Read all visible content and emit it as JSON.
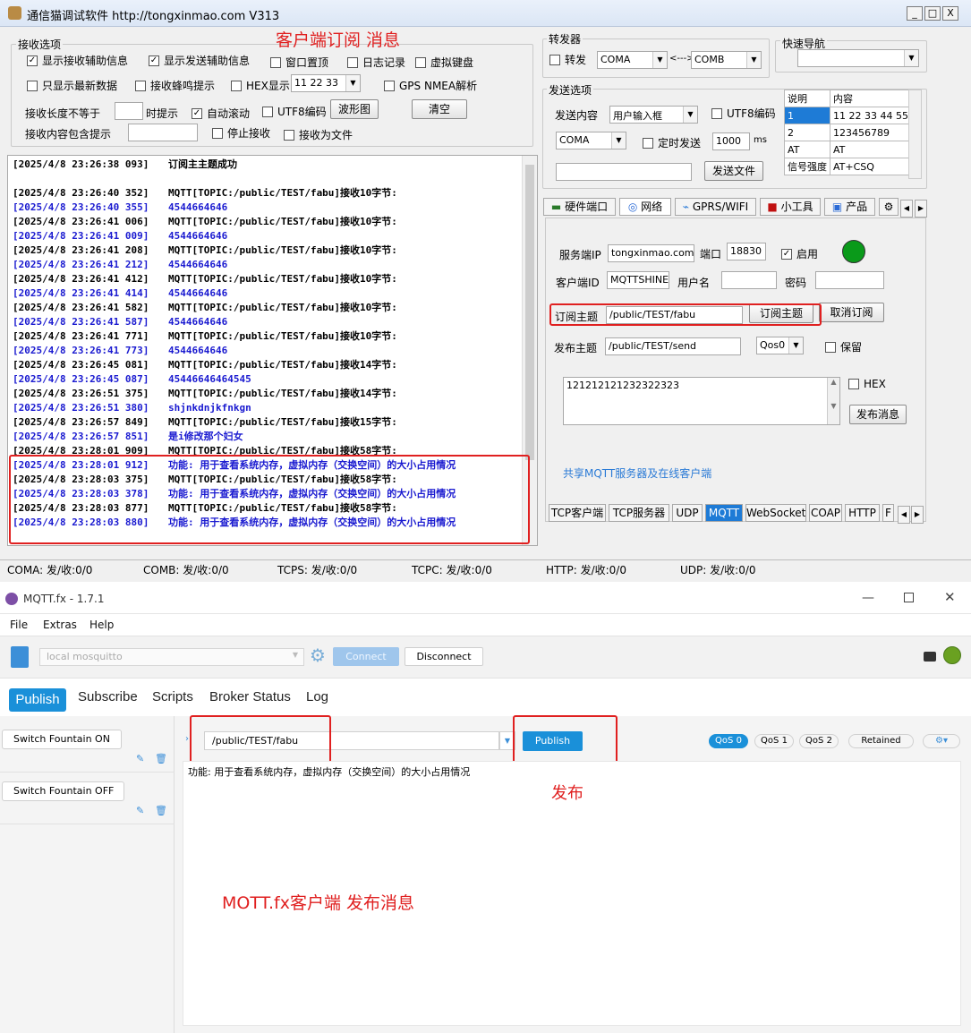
{
  "top_app": {
    "title": "通信猫调试软件  http://tongxinmao.com  V313",
    "window_controls": {
      "minimize": "_",
      "maximize": "□",
      "close": "X"
    },
    "receive_options": {
      "legend": "接收选项",
      "cb_show_recv_aux": "显示接收辅助信息",
      "cb_show_send_aux": "显示发送辅助信息",
      "cb_window_top": "窗口置顶",
      "cb_log": "日志记录",
      "cb_virtual_kbd": "虚拟键盘",
      "cb_latest_only": "只显示最新数据",
      "cb_beep": "接收蜂鸣提示",
      "cb_hex": "HEX显示",
      "hex_value": "11 22 33",
      "cb_gps": "GPS NMEA解析",
      "len_label": "接收长度不等于",
      "len_hint": "时提示",
      "cb_autoscroll": "自动滚动",
      "cb_utf8": "UTF8编码",
      "waveform_btn": "波形图",
      "clear_btn": "清空",
      "contains_label": "接收内容包含提示",
      "cb_stop": "停止接收",
      "cb_to_file": "接收为文件"
    },
    "annotation_subscribe": "客户端订阅   消息",
    "log": [
      {
        "ts": "[2025/4/8 23:26:38 093]",
        "msg": "订阅主主题成功",
        "color": "black"
      },
      {
        "ts": "",
        "msg": "",
        "color": "black"
      },
      {
        "ts": "[2025/4/8 23:26:40 352]",
        "msg": "MQTT[TOPIC:/public/TEST/fabu]接收10字节:",
        "color": "black"
      },
      {
        "ts": "[2025/4/8 23:26:40 355]",
        "msg": "4544664646",
        "color": "blue"
      },
      {
        "ts": "[2025/4/8 23:26:41 006]",
        "msg": "MQTT[TOPIC:/public/TEST/fabu]接收10字节:",
        "color": "black"
      },
      {
        "ts": "[2025/4/8 23:26:41 009]",
        "msg": "4544664646",
        "color": "blue"
      },
      {
        "ts": "[2025/4/8 23:26:41 208]",
        "msg": "MQTT[TOPIC:/public/TEST/fabu]接收10字节:",
        "color": "black"
      },
      {
        "ts": "[2025/4/8 23:26:41 212]",
        "msg": "4544664646",
        "color": "blue"
      },
      {
        "ts": "[2025/4/8 23:26:41 412]",
        "msg": "MQTT[TOPIC:/public/TEST/fabu]接收10字节:",
        "color": "black"
      },
      {
        "ts": "[2025/4/8 23:26:41 414]",
        "msg": "4544664646",
        "color": "blue"
      },
      {
        "ts": "[2025/4/8 23:26:41 582]",
        "msg": "MQTT[TOPIC:/public/TEST/fabu]接收10字节:",
        "color": "black"
      },
      {
        "ts": "[2025/4/8 23:26:41 587]",
        "msg": "4544664646",
        "color": "blue"
      },
      {
        "ts": "[2025/4/8 23:26:41 771]",
        "msg": "MQTT[TOPIC:/public/TEST/fabu]接收10字节:",
        "color": "black"
      },
      {
        "ts": "[2025/4/8 23:26:41 773]",
        "msg": "4544664646",
        "color": "blue"
      },
      {
        "ts": "[2025/4/8 23:26:45 081]",
        "msg": "MQTT[TOPIC:/public/TEST/fabu]接收14字节:",
        "color": "black"
      },
      {
        "ts": "[2025/4/8 23:26:45 087]",
        "msg": "45446646464545",
        "color": "blue"
      },
      {
        "ts": "[2025/4/8 23:26:51 375]",
        "msg": "MQTT[TOPIC:/public/TEST/fabu]接收14字节:",
        "color": "black"
      },
      {
        "ts": "[2025/4/8 23:26:51 380]",
        "msg": "shjnkdnjkfnkgn",
        "color": "blue"
      },
      {
        "ts": "[2025/4/8 23:26:57 849]",
        "msg": "MQTT[TOPIC:/public/TEST/fabu]接收15字节:",
        "color": "black"
      },
      {
        "ts": "[2025/4/8 23:26:57 851]",
        "msg": "是i修改那个妇女",
        "color": "blue"
      },
      {
        "ts": "[2025/4/8 23:28:01 909]",
        "msg": "MQTT[TOPIC:/public/TEST/fabu]接收58字节:",
        "color": "black"
      },
      {
        "ts": "[2025/4/8 23:28:01 912]",
        "msg": "功能: 用于查看系统内存，虚拟内存（交换空间）的大小占用情况",
        "color": "blue"
      },
      {
        "ts": "[2025/4/8 23:28:03 375]",
        "msg": "MQTT[TOPIC:/public/TEST/fabu]接收58字节:",
        "color": "black"
      },
      {
        "ts": "[2025/4/8 23:28:03 378]",
        "msg": "功能: 用于查看系统内存，虚拟内存（交换空间）的大小占用情况",
        "color": "blue"
      },
      {
        "ts": "[2025/4/8 23:28:03 877]",
        "msg": "MQTT[TOPIC:/public/TEST/fabu]接收58字节:",
        "color": "black"
      },
      {
        "ts": "[2025/4/8 23:28:03 880]",
        "msg": "功能: 用于查看系统内存，虚拟内存（交换空间）的大小占用情况",
        "color": "blue"
      }
    ],
    "forwarder": {
      "legend": "转发器",
      "cb_forward": "转发",
      "port_a": "COMA",
      "arrow": "<--->",
      "port_b": "COMB"
    },
    "quick_nav": {
      "legend": "快速导航",
      "value": ""
    },
    "send_options": {
      "legend": "发送选项",
      "content_label": "发送内容",
      "content_value": "用户输入框",
      "cb_utf8": "UTF8编码",
      "port_value": "COMA",
      "cb_timed": "定时发送",
      "interval": "1000",
      "ms": "ms",
      "send_file_btn": "发送文件",
      "send_input": ""
    },
    "cmd_table": {
      "headers": [
        "说明",
        "内容"
      ],
      "rows": [
        [
          "1",
          "11 22 33 44 55"
        ],
        [
          "2",
          "123456789"
        ],
        [
          "AT",
          "AT"
        ],
        [
          "信号强度",
          "AT+CSQ"
        ]
      ]
    },
    "main_tabs": [
      "硬件端口",
      "网络",
      "GPRS/WIFI",
      "小工具",
      "产品"
    ],
    "mqtt_panel": {
      "server_ip_label": "服务端IP",
      "server_ip": "tongxinmao.com",
      "port_label": "端口",
      "port": "18830",
      "cb_enable": "启用",
      "client_id_label": "客户端ID",
      "client_id": "MQTTSHINE",
      "username_label": "用户名",
      "username": "",
      "password_label": "密码",
      "password": "",
      "sub_topic_label": "订阅主题",
      "sub_topic": "/public/TEST/fabu",
      "subscribe_btn": "订阅主题",
      "unsubscribe_btn": "取消订阅",
      "pub_topic_label": "发布主题",
      "pub_topic": "/public/TEST/send",
      "qos": "Qos0",
      "cb_retain": "保留",
      "payload": "121212121232322323",
      "cb_hex": "HEX",
      "publish_btn": "发布消息",
      "shared_link": "共享MQTT服务器及在线客户端",
      "status_color": "#0a9a1a"
    },
    "proto_tabs": [
      "TCP客户端",
      "TCP服务器",
      "UDP",
      "MQTT",
      "WebSockets",
      "COAP",
      "HTTP",
      "F"
    ],
    "active_proto": "MQTT",
    "status": [
      "COMA: 发/收:0/0",
      "COMB: 发/收:0/0",
      "TCPS: 发/收:0/0",
      "TCPC: 发/收:0/0",
      "HTTP: 发/收:0/0",
      "UDP: 发/收:0/0"
    ]
  },
  "bottom_app": {
    "title": "MQTT.fx - 1.7.1",
    "menu": [
      "File",
      "Extras",
      "Help"
    ],
    "profile": "local mosquitto",
    "connect_btn": "Connect",
    "disconnect_btn": "Disconnect",
    "tabs": [
      "Publish",
      "Subscribe",
      "Scripts",
      "Broker Status",
      "Log"
    ],
    "active_tab": "Publish",
    "side_items": [
      "Switch Fountain ON",
      "Switch Fountain OFF"
    ],
    "topic": "/public/TEST/fabu",
    "publish_btn": "Publish",
    "qos": [
      "QoS 0",
      "QoS 1",
      "QoS 2"
    ],
    "retained": "Retained",
    "message": "功能: 用于查看系统内存，虚拟内存（交换空间）的大小占用情况",
    "annotation_publish": "发布",
    "annotation_main": "MOTT.fx客户端 发布消息",
    "accent": "#1a90d9",
    "status_color": "#6aa121"
  }
}
